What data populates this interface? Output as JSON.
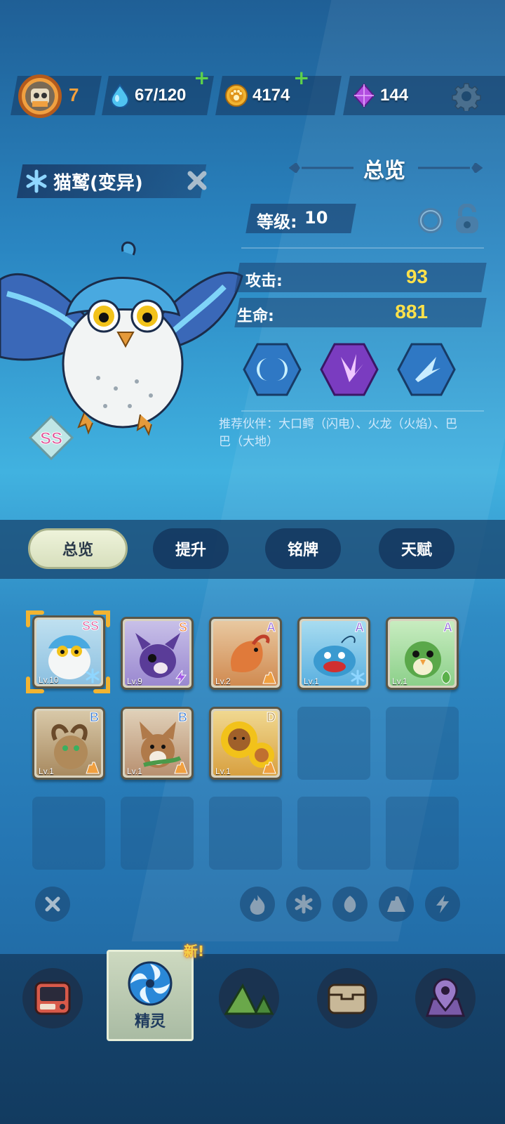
{
  "topbar": {
    "player_level": "7",
    "energy": "67/120",
    "coins": "4174",
    "gems": "144",
    "icons": [
      "avatar",
      "water-drop-icon",
      "paw-coin-icon",
      "gem-icon",
      "gear-icon"
    ]
  },
  "pet": {
    "name": "猫鹫(变异)",
    "rank": "SS",
    "element_icon": "snowflake-icon"
  },
  "overview": {
    "title": "总览",
    "level_label": "等级:",
    "level_value": "10",
    "attack_label": "攻击:",
    "attack_value": "93",
    "hp_label": "生命:",
    "hp_value": "881",
    "skills": [
      "moon-crescents-icon",
      "crystal-shard-icon",
      "feather-arrow-icon"
    ],
    "recommend_text": "推荐伙伴：大口鳄（闪电）、火龙（火焰）、巴巴（大地）"
  },
  "tabs": [
    "总览",
    "提升",
    "铭牌",
    "天赋"
  ],
  "roster": [
    {
      "rank": "SS",
      "level": "Lv.10",
      "element": "snowflake",
      "color": "#4a9fd8",
      "selected": true
    },
    {
      "rank": "S",
      "level": "Lv.9",
      "element": "lightning",
      "color": "#6a4ca8"
    },
    {
      "rank": "A",
      "level": "Lv.2",
      "element": "earth",
      "color": "#d07a3a"
    },
    {
      "rank": "A",
      "level": "Lv.1",
      "element": "snowflake",
      "color": "#3a9ad0"
    },
    {
      "rank": "A",
      "level": "Lv.1",
      "element": "leaf",
      "color": "#5aa84a"
    },
    {
      "rank": "B",
      "level": "Lv.1",
      "element": "earth",
      "color": "#8a6a44"
    },
    {
      "rank": "B",
      "level": "Lv.1",
      "element": "earth",
      "color": "#b07a4a"
    },
    {
      "rank": "D",
      "level": "Lv.1",
      "element": "earth",
      "color": "#d89a30"
    }
  ],
  "filters": [
    "close-icon",
    "fire-icon",
    "snowflake-icon",
    "leaf-icon",
    "earth-icon",
    "lightning-icon"
  ],
  "bottom_nav": {
    "active_label": "精灵",
    "new_badge": "新!",
    "items": [
      "shop-icon",
      "spirit-icon",
      "mountain-icon",
      "chest-icon",
      "map-pin-icon"
    ]
  },
  "colors": {
    "accent_yellow": "#ffe14a",
    "level_orange": "#f4a03c",
    "plus_green": "#5ed24a"
  }
}
